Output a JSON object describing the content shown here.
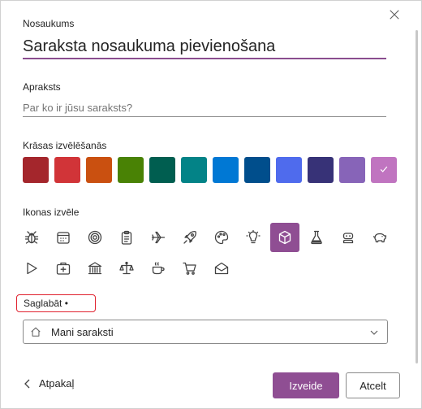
{
  "dialog": {
    "close_icon": "close-icon"
  },
  "title_field": {
    "label": "Nosaukums",
    "value": "Saraksta nosaukuma pievienošana"
  },
  "description_field": {
    "label": "Apraksts",
    "placeholder": "Par ko ir jūsu saraksts?"
  },
  "colors": {
    "label": "Krāsas izvēlēšanās",
    "swatches": [
      "#a4262c",
      "#d13438",
      "#ca5010",
      "#498205",
      "#005e50",
      "#038387",
      "#0078d4",
      "#004e8c",
      "#4f6bed",
      "#373277",
      "#8764b8",
      "#c074c0"
    ],
    "selected_index": 11,
    "check_icon": "check-icon"
  },
  "icons": {
    "label": "Ikonas izvēle",
    "items": [
      "bug-icon",
      "calendar-icon",
      "target-icon",
      "clipboard-icon",
      "airplane-icon",
      "rocket-icon",
      "palette-icon",
      "lightbulb-icon",
      "cube-icon",
      "beaker-icon",
      "robot-icon",
      "piggy-bank-icon",
      "play-icon",
      "first-aid-icon",
      "bank-icon",
      "scale-icon",
      "coffee-icon",
      "cart-icon",
      "mail-open-icon"
    ],
    "selected": "cube-icon"
  },
  "save_to": {
    "label": "Saglabāt •",
    "selected": "Mani saraksti",
    "icon": "home-icon",
    "dropdown_icon": "chevron-down-icon"
  },
  "footer": {
    "back_label": "Atpakaļ",
    "create_label": "Izveide",
    "cancel_label": "Atcelt"
  },
  "accent_color": "#8f4e93"
}
